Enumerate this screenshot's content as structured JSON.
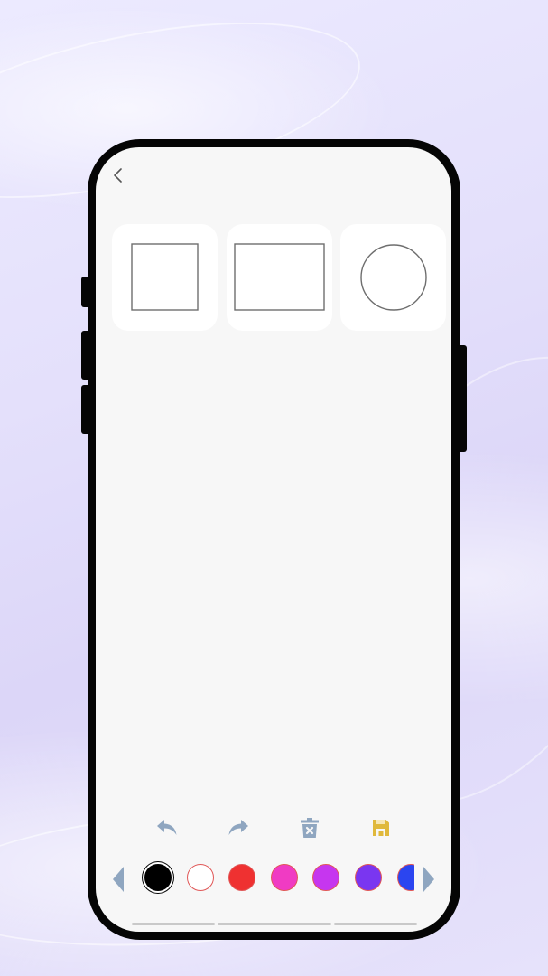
{
  "app": {
    "screen": "shape-drawing"
  },
  "navigation": {
    "back_icon": "chevron-left-icon"
  },
  "shapes": [
    {
      "name": "square",
      "icon": "square-shape-icon"
    },
    {
      "name": "rectangle",
      "icon": "rectangle-shape-icon"
    },
    {
      "name": "circle",
      "icon": "circle-shape-icon"
    }
  ],
  "toolbar": {
    "undo_icon": "undo-icon",
    "redo_icon": "redo-icon",
    "clear_icon": "trash-icon",
    "save_icon": "save-icon",
    "tool_color": "#8fa6c0",
    "save_color": "#e0b93c"
  },
  "palette": {
    "prev_icon": "chevron-left-icon",
    "next_icon": "chevron-right-icon",
    "arrow_color": "#8fa6c0",
    "colors": [
      "#000000",
      "#ffffff",
      "#ef3131",
      "#f03bc3",
      "#c636ef",
      "#7a36f0",
      "#2b45f0"
    ]
  }
}
